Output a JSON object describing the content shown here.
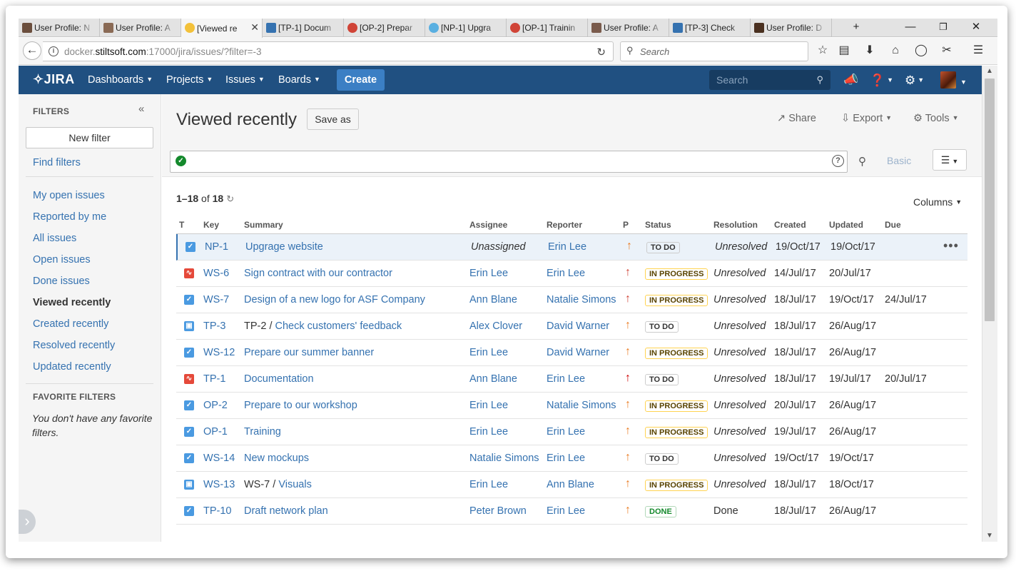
{
  "browser": {
    "tabs": [
      {
        "label": "User Profile: N",
        "icon": "user-avatar-icon",
        "color": "#6b4e3d"
      },
      {
        "label": "User Profile: A",
        "icon": "user-avatar-icon",
        "color": "#8a6a55"
      },
      {
        "label": "[Viewed re",
        "icon": "emoji-icon",
        "color": "#f3c13a",
        "active": true
      },
      {
        "label": "[TP-1] Docum",
        "icon": "jira-project-icon",
        "color": "#3572b0"
      },
      {
        "label": "[OP-2] Prepar",
        "icon": "power-icon",
        "color": "#d04437"
      },
      {
        "label": "[NP-1] Upgra",
        "icon": "globe-icon",
        "color": "#59afe1"
      },
      {
        "label": "[OP-1] Trainin",
        "icon": "power-icon",
        "color": "#d04437"
      },
      {
        "label": "User Profile: A",
        "icon": "user-avatar-icon",
        "color": "#7a5b4c"
      },
      {
        "label": "[TP-3] Check",
        "icon": "jira-project-icon",
        "color": "#3572b0"
      },
      {
        "label": "User Profile: D",
        "icon": "user-avatar-icon",
        "color": "#4a3020"
      }
    ],
    "new_tab": "+",
    "url_host": "docker.",
    "url_domain": "stiltsoft.com",
    "url_rest": ":17000/jira/issues/?filter=-3",
    "search_placeholder": "Search"
  },
  "jira": {
    "logo": "JIRA",
    "nav": [
      "Dashboards",
      "Projects",
      "Issues",
      "Boards"
    ],
    "create": "Create",
    "search_placeholder": "Search"
  },
  "sidebar": {
    "filters_heading": "FILTERS",
    "new_filter": "New filter",
    "find_filters": "Find filters",
    "links": [
      "My open issues",
      "Reported by me",
      "All issues",
      "Open issues",
      "Done issues",
      "Viewed recently",
      "Created recently",
      "Resolved recently",
      "Updated recently"
    ],
    "current": "Viewed recently",
    "favorite_heading": "FAVORITE FILTERS",
    "no_favorites": "You don't have any favorite filters."
  },
  "main": {
    "title": "Viewed recently",
    "save_as": "Save as",
    "share": "Share",
    "export": "Export",
    "tools": "Tools",
    "basic": "Basic",
    "count_range": "1–18",
    "count_of": "of",
    "count_total": "18",
    "columns": "Columns"
  },
  "table": {
    "headers": [
      "T",
      "Key",
      "Summary",
      "Assignee",
      "Reporter",
      "P",
      "Status",
      "Resolution",
      "Created",
      "Updated",
      "Due"
    ],
    "rows": [
      {
        "type": "task",
        "key": "NP-1",
        "parent": "",
        "summary": "Upgrage website",
        "assignee": "Unassigned",
        "reporter": "Erin Lee",
        "priority": "medium",
        "status": "TO DO",
        "resolution": "Unresolved",
        "created": "19/Oct/17",
        "updated": "19/Oct/17",
        "due": ""
      },
      {
        "type": "bug",
        "key": "WS-6",
        "parent": "",
        "summary": "Sign contract with our contractor",
        "assignee": "Erin Lee",
        "reporter": "Erin Lee",
        "priority": "high",
        "status": "IN PROGRESS",
        "resolution": "Unresolved",
        "created": "14/Jul/17",
        "updated": "20/Jul/17",
        "due": ""
      },
      {
        "type": "task",
        "key": "WS-7",
        "parent": "",
        "summary": "Design of a new logo for ASF Company",
        "assignee": "Ann Blane",
        "reporter": "Natalie Simons",
        "priority": "high",
        "status": "IN PROGRESS",
        "resolution": "Unresolved",
        "created": "18/Jul/17",
        "updated": "19/Oct/17",
        "due": "24/Jul/17"
      },
      {
        "type": "subtask",
        "key": "TP-3",
        "parent": "TP-2",
        "summary": "Check customers' feedback",
        "assignee": "Alex Clover",
        "reporter": "David Warner",
        "priority": "medium",
        "status": "TO DO",
        "resolution": "Unresolved",
        "created": "18/Jul/17",
        "updated": "26/Aug/17",
        "due": ""
      },
      {
        "type": "task",
        "key": "WS-12",
        "parent": "",
        "summary": "Prepare our summer banner",
        "assignee": "Erin Lee",
        "reporter": "David Warner",
        "priority": "medium",
        "status": "IN PROGRESS",
        "resolution": "Unresolved",
        "created": "18/Jul/17",
        "updated": "26/Aug/17",
        "due": ""
      },
      {
        "type": "bug",
        "key": "TP-1",
        "parent": "",
        "summary": "Documentation",
        "assignee": "Ann Blane",
        "reporter": "Erin Lee",
        "priority": "highest",
        "status": "TO DO",
        "resolution": "Unresolved",
        "created": "18/Jul/17",
        "updated": "19/Jul/17",
        "due": "20/Jul/17"
      },
      {
        "type": "task",
        "key": "OP-2",
        "parent": "",
        "summary": "Prepare to our workshop",
        "assignee": "Erin Lee",
        "reporter": "Natalie Simons",
        "priority": "medium",
        "status": "IN PROGRESS",
        "resolution": "Unresolved",
        "created": "20/Jul/17",
        "updated": "26/Aug/17",
        "due": ""
      },
      {
        "type": "task",
        "key": "OP-1",
        "parent": "",
        "summary": "Training",
        "assignee": "Erin Lee",
        "reporter": "Erin Lee",
        "priority": "medium",
        "status": "IN PROGRESS",
        "resolution": "Unresolved",
        "created": "19/Jul/17",
        "updated": "26/Aug/17",
        "due": ""
      },
      {
        "type": "task",
        "key": "WS-14",
        "parent": "",
        "summary": "New mockups",
        "assignee": "Natalie Simons",
        "reporter": "Erin Lee",
        "priority": "medium",
        "status": "TO DO",
        "resolution": "Unresolved",
        "created": "19/Oct/17",
        "updated": "19/Oct/17",
        "due": ""
      },
      {
        "type": "subtask",
        "key": "WS-13",
        "parent": "WS-7",
        "summary": "Visuals",
        "assignee": "Erin Lee",
        "reporter": "Ann Blane",
        "priority": "medium",
        "status": "IN PROGRESS",
        "resolution": "Unresolved",
        "created": "18/Jul/17",
        "updated": "18/Oct/17",
        "due": ""
      },
      {
        "type": "task",
        "key": "TP-10",
        "parent": "",
        "summary": "Draft network plan",
        "assignee": "Peter Brown",
        "reporter": "Erin Lee",
        "priority": "medium",
        "status": "DONE",
        "resolution": "Done",
        "created": "18/Jul/17",
        "updated": "26/Aug/17",
        "due": ""
      }
    ]
  },
  "colors": {
    "header_bg": "#205081",
    "link": "#3572b0",
    "create_btn": "#3b7fc4",
    "task_icon": "#4a9ae1",
    "bug_icon": "#e5493a",
    "priority_high": "#d04437",
    "priority_highest": "#ce0000",
    "priority_medium": "#ea7d24",
    "status_todo": "#333333",
    "status_inprogress": "#594300",
    "status_inprogress_border": "#ffd351",
    "status_done": "#14892c",
    "status_done_border": "#b2d8b9"
  }
}
